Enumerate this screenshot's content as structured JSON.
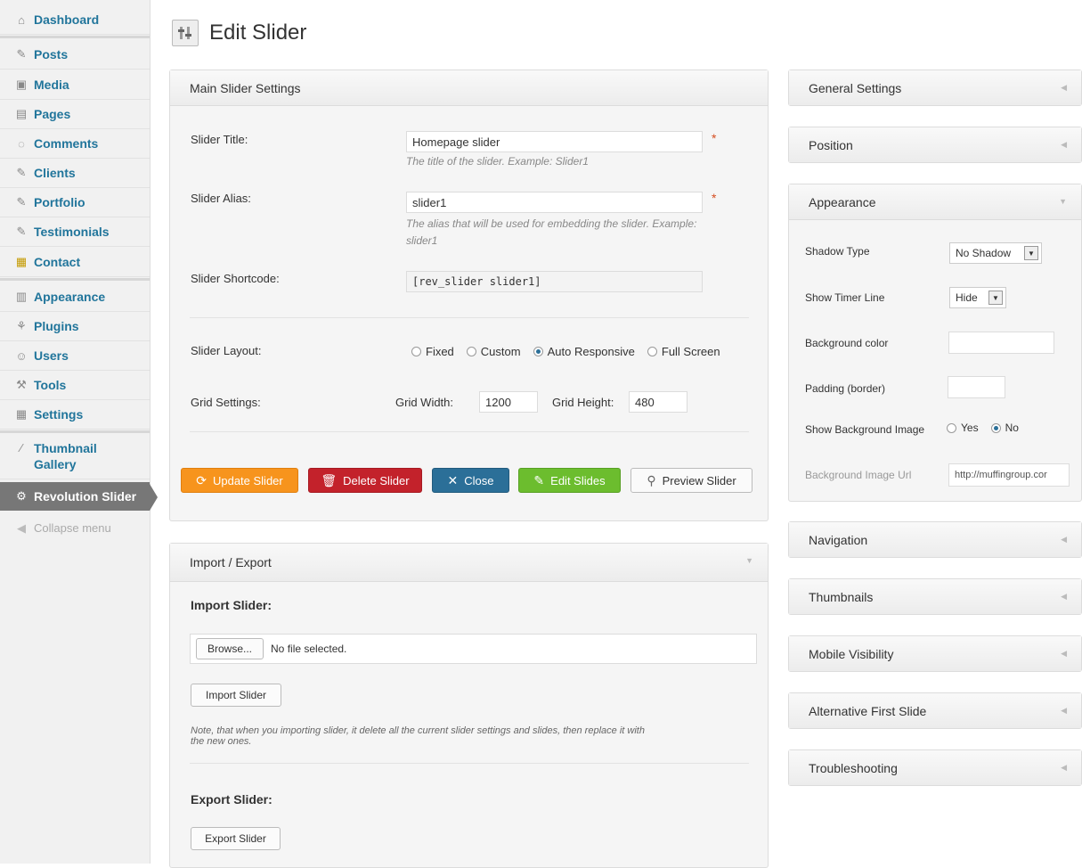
{
  "sidebar": {
    "items": [
      {
        "label": "Dashboard",
        "icon": "home-icon"
      },
      {
        "label": "Posts",
        "icon": "pin-icon"
      },
      {
        "label": "Media",
        "icon": "media-icon"
      },
      {
        "label": "Pages",
        "icon": "pages-icon"
      },
      {
        "label": "Comments",
        "icon": "comment-icon"
      },
      {
        "label": "Clients",
        "icon": "pin-icon"
      },
      {
        "label": "Portfolio",
        "icon": "pin-icon"
      },
      {
        "label": "Testimonials",
        "icon": "pin-icon"
      },
      {
        "label": "Contact",
        "icon": "contact-icon"
      },
      {
        "label": "Appearance",
        "icon": "appearance-icon"
      },
      {
        "label": "Plugins",
        "icon": "plugin-icon"
      },
      {
        "label": "Users",
        "icon": "users-icon"
      },
      {
        "label": "Tools",
        "icon": "tools-icon"
      },
      {
        "label": "Settings",
        "icon": "settings-icon"
      }
    ],
    "thumbnail_line1": "Thumbnail",
    "thumbnail_line2": "Gallery",
    "revolution": "Revolution Slider",
    "collapse": "Collapse menu"
  },
  "page": {
    "title": "Edit Slider"
  },
  "main": {
    "header": "Main Slider Settings",
    "title_label": "Slider Title:",
    "title_value": "Homepage slider",
    "title_hint": "The title of the slider. Example: Slider1",
    "alias_label": "Slider Alias:",
    "alias_value": "slider1",
    "alias_hint_1": "The alias that will be used for embedding the slider. Example:",
    "alias_hint_2": "slider1",
    "shortcode_label": "Slider Shortcode:",
    "shortcode_value": "[rev_slider slider1]",
    "layout_label": "Slider Layout:",
    "layout_options": [
      "Fixed",
      "Custom",
      "Auto Responsive",
      "Full Screen"
    ],
    "layout_selected": "Auto Responsive",
    "grid_label": "Grid Settings:",
    "grid_width_label": "Grid Width:",
    "grid_width": "1200",
    "grid_height_label": "Grid Height:",
    "grid_height": "480",
    "required_mark": "*"
  },
  "buttons": {
    "update": "Update Slider",
    "delete": "Delete Slider",
    "close": "Close",
    "edit": "Edit Slides",
    "preview": "Preview Slider"
  },
  "import_export": {
    "header": "Import / Export",
    "import_heading": "Import Slider:",
    "browse": "Browse...",
    "no_file": "No file selected.",
    "import_button": "Import Slider",
    "note_1": "Note, that when you importing slider, it delete all the current slider settings and slides, then replace it with",
    "note_2": "the new ones.",
    "export_heading": "Export Slider:",
    "export_button": "Export Slider"
  },
  "right": {
    "general": "General Settings",
    "position": "Position",
    "appearance": "Appearance",
    "shadow_label": "Shadow Type",
    "shadow_value": "No Shadow",
    "timer_label": "Show Timer Line",
    "timer_value": "Hide",
    "bg_color_label": "Background color",
    "padding_label": "Padding (border)",
    "show_bg_label": "Show Background Image",
    "yes": "Yes",
    "no": "No",
    "show_bg_selected": "No",
    "bg_url_label": "Background Image Url",
    "bg_url_value": "http://muffingroup.cor",
    "navigation": "Navigation",
    "thumbnails": "Thumbnails",
    "mobile": "Mobile Visibility",
    "alt_first": "Alternative First Slide",
    "troubleshooting": "Troubleshooting"
  },
  "colors": {
    "link": "#21759b",
    "orange": "#f7941d",
    "red": "#c3222b",
    "blue": "#2b6f98",
    "green": "#6cbd2e"
  }
}
